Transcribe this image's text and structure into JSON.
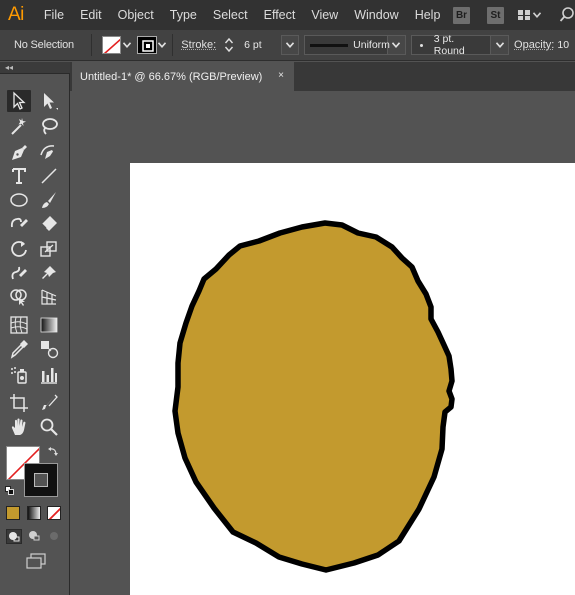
{
  "app": {
    "logo": "Ai",
    "menus": [
      "File",
      "Edit",
      "Object",
      "Type",
      "Select",
      "Effect",
      "View",
      "Window",
      "Help"
    ],
    "bridge_buttons": [
      "Br",
      "St"
    ]
  },
  "control_bar": {
    "selection_label": "No Selection",
    "stroke_label": "Stroke:",
    "stroke_weight": "6 pt",
    "variable_width_profile": "Uniform",
    "brush_definition": "3 pt. Round",
    "opacity_label": "Opacity:",
    "opacity_value": "10"
  },
  "document_tab": {
    "title": "Untitled-1* @ 66.67% (RGB/Preview)",
    "close_glyph": "×"
  },
  "colors": {
    "shape_fill": "#c39a2e",
    "shape_stroke": "#000000",
    "accent_logo": "#ff9a00"
  },
  "icons": [
    "selection-tool-icon",
    "direct-selection-tool-icon",
    "magic-wand-icon",
    "lasso-icon",
    "pen-tool-icon",
    "curvature-tool-icon",
    "type-tool-icon",
    "line-tool-icon",
    "ellipse-tool-icon",
    "paintbrush-icon",
    "shaper-tool-icon",
    "eraser-icon",
    "rotate-tool-icon",
    "scale-tool-icon",
    "warp-tool-icon",
    "puppet-warp-icon",
    "shape-builder-icon",
    "perspective-grid-icon",
    "mesh-tool-icon",
    "gradient-tool-icon",
    "eyedropper-icon",
    "blend-tool-icon",
    "symbol-sprayer-icon",
    "graph-tool-icon",
    "artboard-tool-icon",
    "slice-tool-icon",
    "hand-tool-icon",
    "zoom-tool-icon"
  ]
}
